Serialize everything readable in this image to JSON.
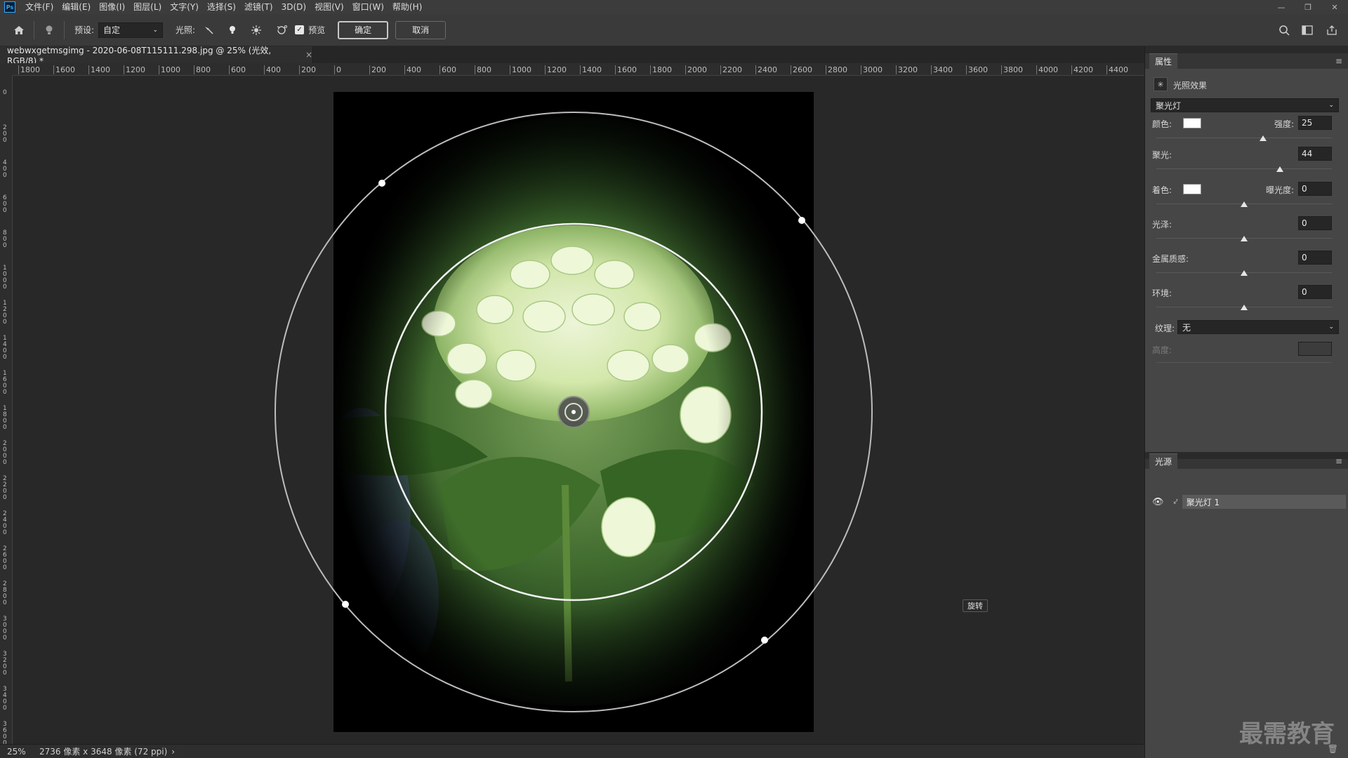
{
  "menubar": {
    "logo": "Ps",
    "items": [
      "文件(F)",
      "编辑(E)",
      "图像(I)",
      "图层(L)",
      "文字(Y)",
      "选择(S)",
      "滤镜(T)",
      "3D(D)",
      "视图(V)",
      "窗口(W)",
      "帮助(H)"
    ]
  },
  "optionsbar": {
    "preset_label": "预设:",
    "preset_value": "自定",
    "lighting_label": "光照:",
    "preview_label": "预览",
    "preview_checked": true,
    "ok_label": "确定",
    "cancel_label": "取消"
  },
  "document": {
    "tab_title": "webwxgetmsgimg - 2020-06-08T115111.298.jpg @ 25% (光效, RGB/8) *",
    "close": "×"
  },
  "rulers": {
    "horizontal": [
      "1800",
      "1600",
      "1400",
      "1200",
      "1000",
      "800",
      "600",
      "400",
      "200",
      "0",
      "200",
      "400",
      "600",
      "800",
      "1000",
      "1200",
      "1400",
      "1600",
      "1800",
      "2000",
      "2200",
      "2400",
      "2600",
      "2800",
      "3000",
      "3200",
      "3400",
      "3600",
      "3800",
      "4000",
      "4200",
      "4400"
    ],
    "vertical": [
      "0",
      "200",
      "400",
      "600",
      "800",
      "1000",
      "1200",
      "1400",
      "1600",
      "1800",
      "2000",
      "2200",
      "2400",
      "2600",
      "2800",
      "3000",
      "3200",
      "3400",
      "3600"
    ]
  },
  "canvas": {
    "tooltip": "旋转"
  },
  "statusbar": {
    "zoom": "25%",
    "info": "2736 像素 x 3648 像素 (72 ppi)",
    "arrow": "›"
  },
  "properties": {
    "tab": "属性",
    "title": "光照效果",
    "light_type": "聚光灯",
    "color_label": "颜色:",
    "intensity_label": "强度:",
    "intensity_value": "25",
    "hotspot_label": "聚光:",
    "hotspot_value": "44",
    "colorize_label": "着色:",
    "exposure_label": "曝光度:",
    "exposure_value": "0",
    "gloss_label": "光泽:",
    "gloss_value": "0",
    "metallic_label": "金属质感:",
    "metallic_value": "0",
    "ambience_label": "环境:",
    "ambience_value": "0",
    "texture_label": "纹理:",
    "texture_value": "无",
    "height_label": "高度:"
  },
  "lights": {
    "tab": "光源",
    "items": [
      {
        "label": "聚光灯 1"
      }
    ]
  },
  "watermark": "最需教育",
  "colors": {
    "accent": "#31a8ff",
    "scroll_accent": "#5fbf5f"
  }
}
